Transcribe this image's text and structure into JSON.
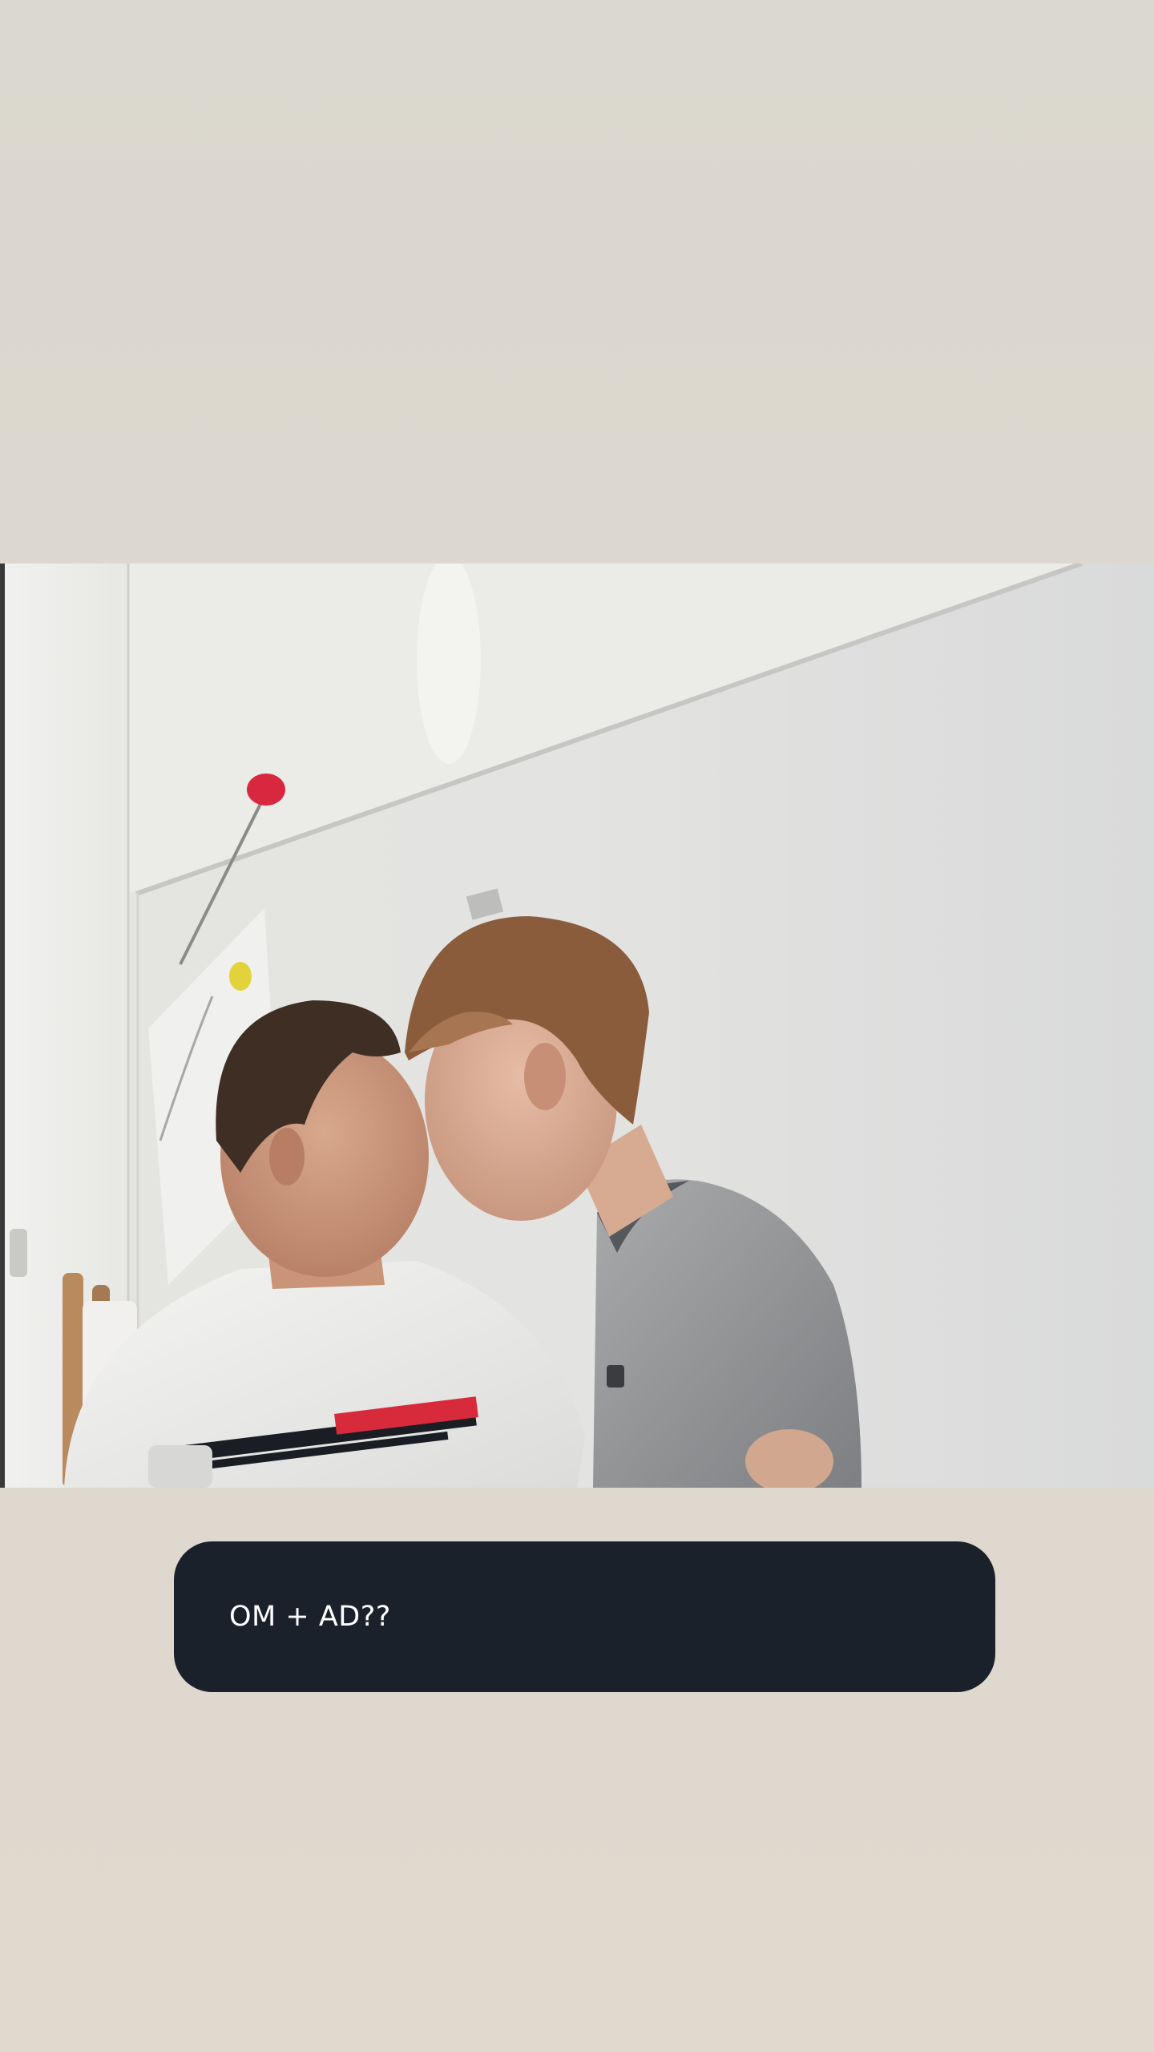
{
  "story": {
    "caption": "OM + AD??"
  },
  "colors": {
    "background_top": "#dad8cf",
    "background_bottom": "#e1d9ce",
    "caption_background": "#1b212b",
    "caption_text": "#ffffff"
  }
}
